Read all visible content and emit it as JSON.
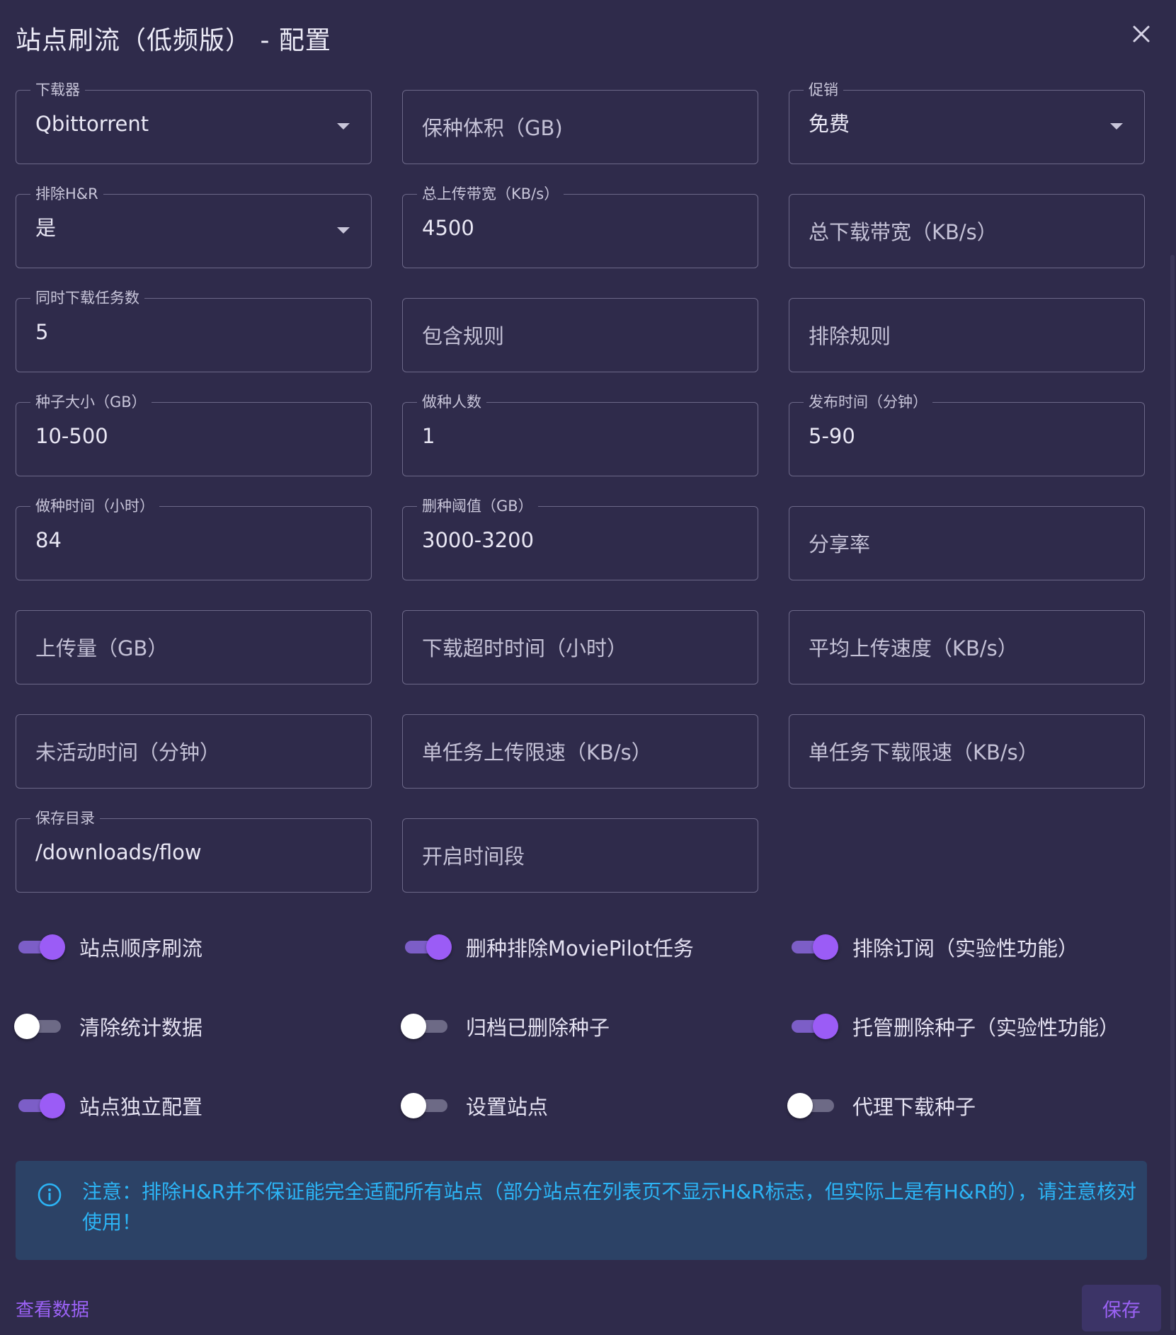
{
  "dialog": {
    "title": "站点刷流（低频版） - 配置",
    "close_icon": "close-icon"
  },
  "fields": {
    "downloader": {
      "label": "下载器",
      "value": "Qbittorrent",
      "type": "select"
    },
    "keep_size": {
      "placeholder": "保种体积（GB)"
    },
    "promotion": {
      "label": "促销",
      "value": "免费",
      "type": "select"
    },
    "exclude_hr": {
      "label": "排除H&R",
      "value": "是",
      "type": "select"
    },
    "total_upload_bw": {
      "label": "总上传带宽（KB/s）",
      "value": "4500"
    },
    "total_download_bw": {
      "placeholder": "总下载带宽（KB/s）"
    },
    "concurrent_tasks": {
      "label": "同时下载任务数",
      "value": "5"
    },
    "include_rules": {
      "placeholder": "包含规则"
    },
    "exclude_rules": {
      "placeholder": "排除规则"
    },
    "torrent_size": {
      "label": "种子大小（GB）",
      "value": "10-500"
    },
    "seeders": {
      "label": "做种人数",
      "value": "1"
    },
    "publish_time": {
      "label": "发布时间（分钟）",
      "value": "5-90"
    },
    "seed_time": {
      "label": "做种时间（小时）",
      "value": "84"
    },
    "delete_threshold": {
      "label": "删种阈值（GB）",
      "value": "3000-3200"
    },
    "share_ratio": {
      "placeholder": "分享率"
    },
    "upload_amount": {
      "placeholder": "上传量（GB）"
    },
    "download_timeout": {
      "placeholder": "下载超时时间（小时）"
    },
    "avg_upload_speed": {
      "placeholder": "平均上传速度（KB/s）"
    },
    "inactive_time": {
      "placeholder": "未活动时间（分钟）"
    },
    "task_upload_limit": {
      "placeholder": "单任务上传限速（KB/s）"
    },
    "task_download_limit": {
      "placeholder": "单任务下载限速（KB/s）"
    },
    "save_dir": {
      "label": "保存目录",
      "value": "/downloads/flow"
    },
    "active_period": {
      "placeholder": "开启时间段"
    }
  },
  "toggles": [
    {
      "label": "站点顺序刷流",
      "on": true
    },
    {
      "label": "删种排除MoviePilot任务",
      "on": true
    },
    {
      "label": "排除订阅（实验性功能）",
      "on": true
    },
    {
      "label": "清除统计数据",
      "on": false
    },
    {
      "label": "归档已删除种子",
      "on": false
    },
    {
      "label": "托管删除种子（实验性功能）",
      "on": true
    },
    {
      "label": "站点独立配置",
      "on": true
    },
    {
      "label": "设置站点",
      "on": false
    },
    {
      "label": "代理下载种子",
      "on": false
    }
  ],
  "alert": {
    "icon": "info-icon",
    "text": "注意：排除H&R并不保证能完全适配所有站点（部分站点在列表页不显示H&R标志，但实际上是有H&R的），请注意核对使用！"
  },
  "footer": {
    "view_data_label": "查看数据",
    "save_label": "保存"
  },
  "colors": {
    "background": "#2f2b4b",
    "accent": "#9b5cf6",
    "alert_bg": "#2c4266",
    "alert_text": "#2cb4f5"
  }
}
